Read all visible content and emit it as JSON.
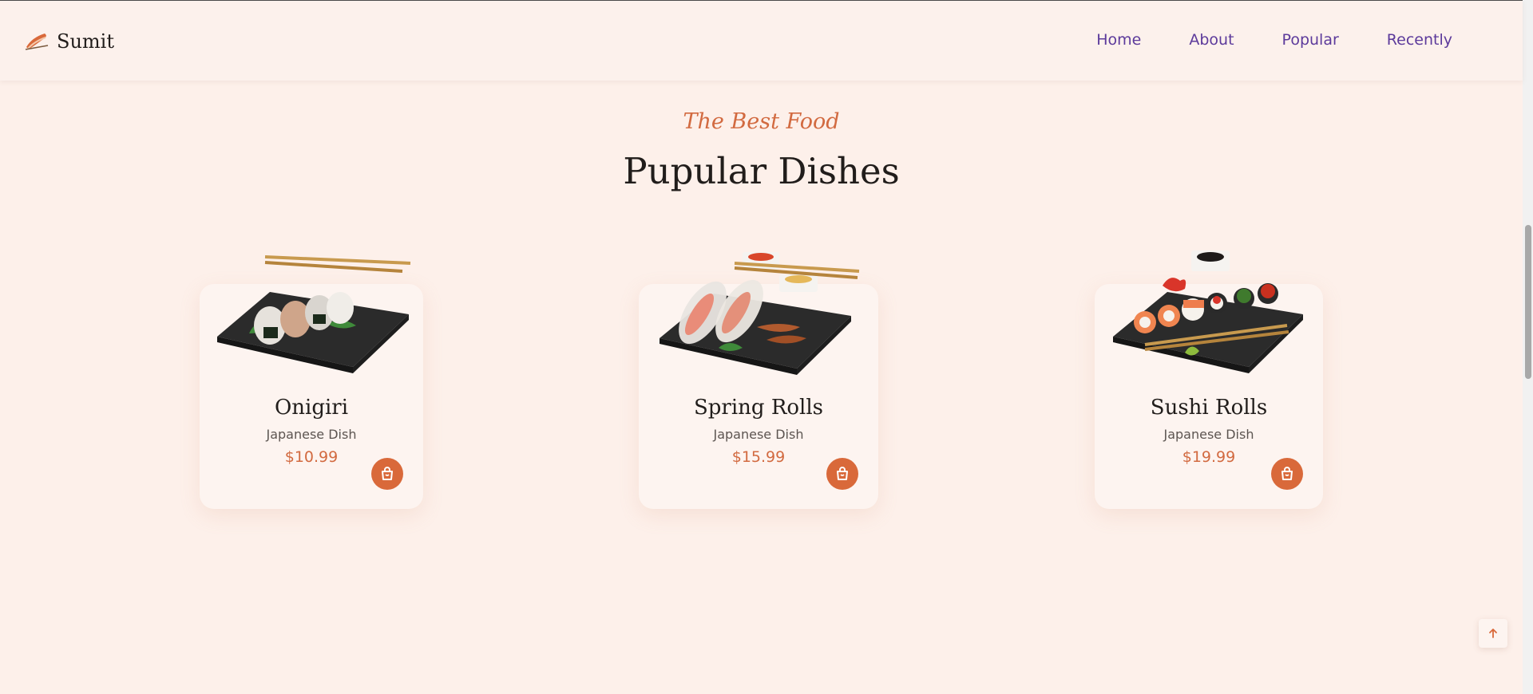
{
  "header": {
    "logo_text": "Sumit",
    "logo_icon": "sushi-icon",
    "nav": [
      {
        "label": "Home"
      },
      {
        "label": "About"
      },
      {
        "label": "Popular"
      },
      {
        "label": "Recently"
      }
    ]
  },
  "section": {
    "subtitle": "The Best Food",
    "title": "Pupular Dishes"
  },
  "dishes": [
    {
      "name": "Onigiri",
      "description": "Japanese Dish",
      "price": "$10.99"
    },
    {
      "name": "Spring Rolls",
      "description": "Japanese Dish",
      "price": "$15.99"
    },
    {
      "name": "Sushi Rolls",
      "description": "Japanese Dish",
      "price": "$19.99"
    }
  ],
  "colors": {
    "accent": "#d9693a",
    "nav_link": "#5c3a9b",
    "background": "#fdf0ea",
    "card": "#fdf4f0"
  },
  "icons": {
    "cart": "shopping-bag-icon",
    "scroll_up": "arrow-up-icon"
  }
}
